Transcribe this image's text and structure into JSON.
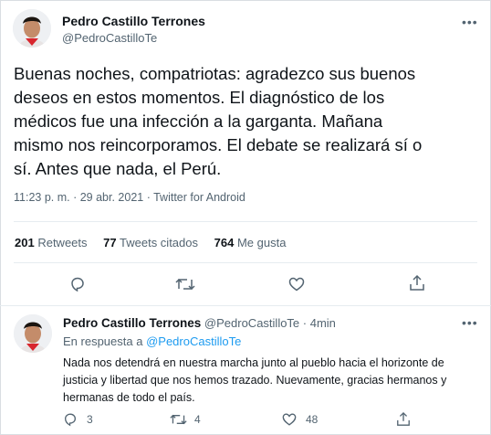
{
  "main_tweet": {
    "author_name": "Pedro Castillo Terrones",
    "author_handle": "@PedroCastilloTe",
    "text_lines": [
      "Buenas noches, compatriotas: agradezco sus buenos",
      "deseos en estos momentos. El diagnóstico de los",
      "médicos fue una infección a la garganta. Mañana",
      "mismo nos reincorporamos. El debate se realizará sí o",
      "sí. Antes que nada, el Perú."
    ],
    "meta": "11:23 p. m. · 29 abr. 2021 · Twitter for Android",
    "stats": {
      "retweets_count": "201",
      "retweets_label": "Retweets",
      "quotes_count": "77",
      "quotes_label": "Tweets citados",
      "likes_count": "764",
      "likes_label": "Me gusta"
    }
  },
  "reply": {
    "author_name": "Pedro Castillo Terrones",
    "author_handle": "@PedroCastilloTe",
    "time": "· 4min",
    "reply_prefix": "En respuesta a",
    "reply_to": "@PedroCastilloTe",
    "text_lines": [
      "Nada nos detendrá en nuestra marcha junto al pueblo hacia el horizonte de",
      "justicia y libertad que nos hemos trazado. Nuevamente, gracias hermanos y",
      "hermanas de todo el país."
    ],
    "actions": {
      "reply_count": "3",
      "retweet_count": "4",
      "like_count": "48"
    }
  },
  "colors": {
    "accent": "#1d9bf0",
    "muted": "#536471",
    "text": "#0f1419",
    "divider": "#e6ecf0"
  },
  "icons": [
    "more-icon",
    "reply-icon",
    "retweet-icon",
    "like-icon",
    "share-icon"
  ]
}
